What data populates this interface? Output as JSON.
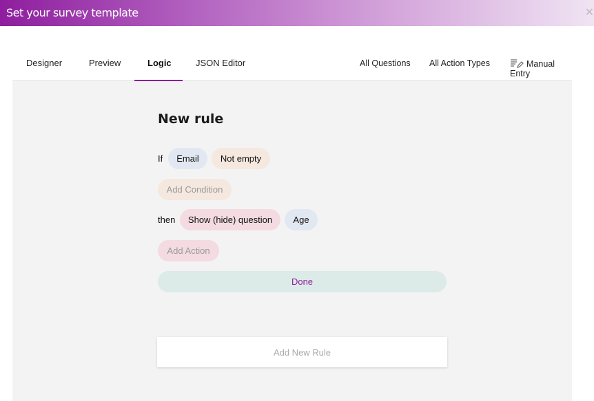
{
  "window": {
    "title": "Set your survey template",
    "close_icon": "close-icon"
  },
  "tabs": [
    {
      "label": "Designer"
    },
    {
      "label": "Preview"
    },
    {
      "label": "Logic",
      "active": true
    },
    {
      "label": "JSON Editor"
    }
  ],
  "toolbar": {
    "all_questions": "All Questions",
    "all_action_types": "All Action Types",
    "manual_entry": "Manual Entry",
    "manual_entry_icon": "edit-list-icon"
  },
  "rule": {
    "title": "New rule",
    "if_label": "If",
    "condition_question": "Email",
    "condition_operator": "Not empty",
    "add_condition": "Add Condition",
    "then_label": "then",
    "action_type": "Show (hide) question",
    "action_target": "Age",
    "add_action": "Add Action",
    "done": "Done"
  },
  "add_new_rule": "Add New Rule",
  "colors": {
    "accent": "#8e1e9e"
  }
}
